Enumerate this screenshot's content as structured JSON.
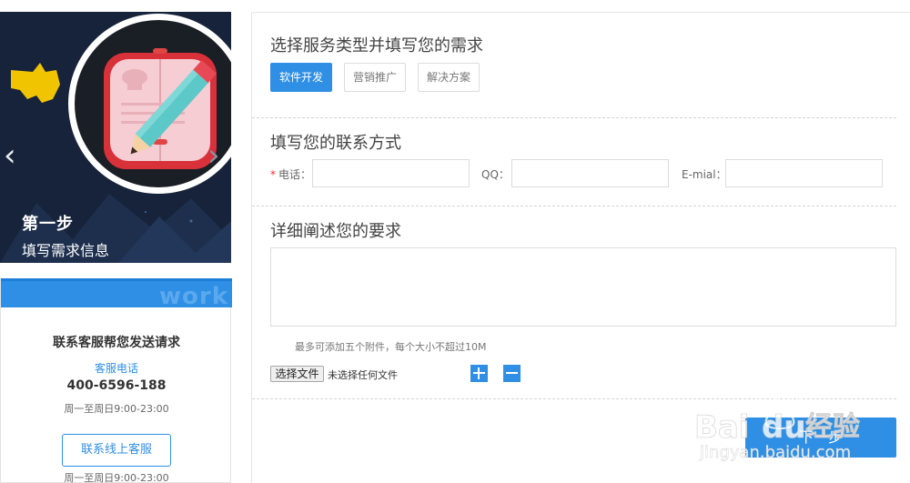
{
  "banner": {
    "step_title": "第一步",
    "step_subtitle": "填写需求信息",
    "prev_arrow": "‹",
    "next_arrow": "›"
  },
  "contact_card": {
    "watermark": "work",
    "title": "联系客服帮您发送请求",
    "phone_label": "客服电话",
    "phone": "400-6596-188",
    "hours_phone": "周一至周日9:00-23:00",
    "online_button": "联系线上客服",
    "hours_online": "周一至周日9:00-23:00"
  },
  "form": {
    "section1_title": "选择服务类型并填写您的需求",
    "services": [
      "软件开发",
      "营销推广",
      "解决方案"
    ],
    "section2_title": "填写您的联系方式",
    "phone_label": "电话：",
    "required_mark": "*",
    "qq_label": "QQ：",
    "email_label": "E-mial：",
    "section3_title": "详细阐述您的要求",
    "attachment_hint": "最多可添加五个附件，每个大小不超过10M",
    "choose_file": "选择文件",
    "no_file": "未选择任何文件",
    "next_button": "下一步"
  },
  "watermark": {
    "brand": "Bai",
    "brand2": "du",
    "suffix": "经验",
    "url": "jingyan.baidu.com"
  },
  "colors": {
    "accent": "#2f8fe4",
    "banner_bg": "#16233a",
    "required": "#e33333"
  }
}
